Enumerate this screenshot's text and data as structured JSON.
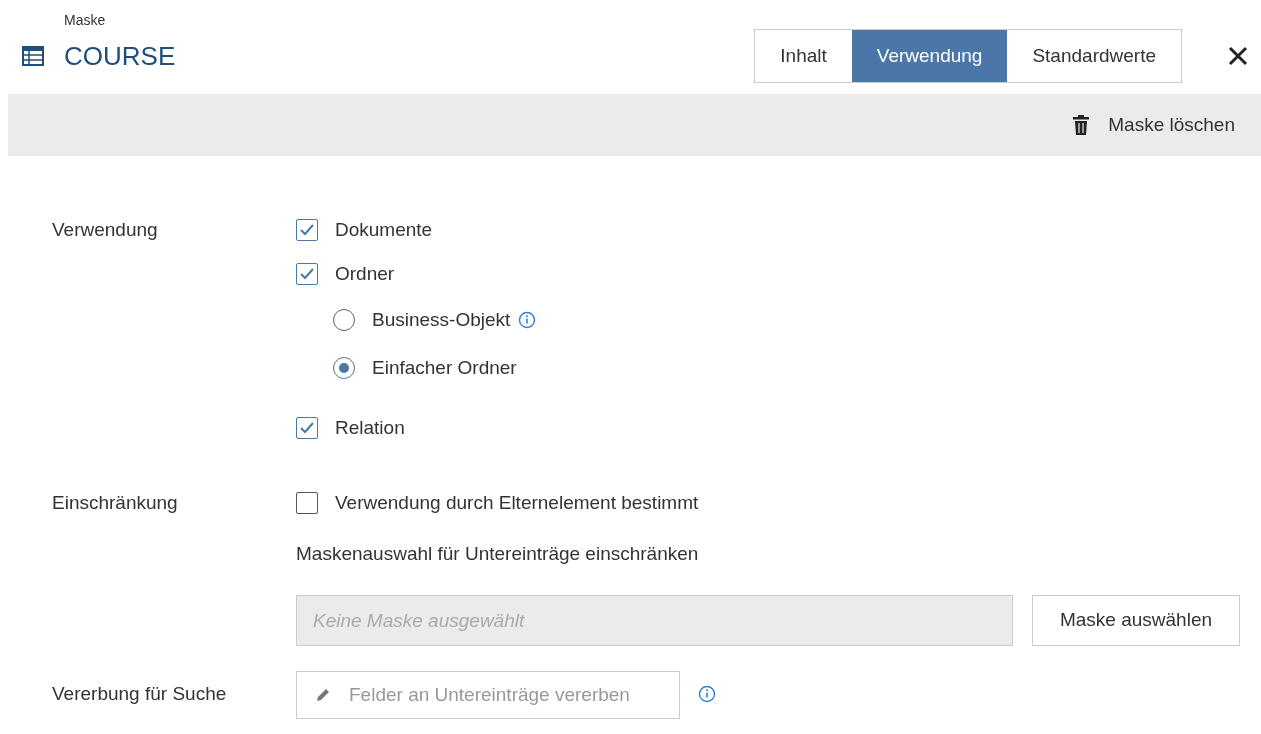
{
  "header": {
    "caption": "Maske",
    "title": "COURSE"
  },
  "tabs": [
    {
      "label": "Inhalt",
      "selected": false
    },
    {
      "label": "Verwendung",
      "selected": true
    },
    {
      "label": "Standardwerte",
      "selected": false
    }
  ],
  "toolbar": {
    "delete_label": "Maske löschen"
  },
  "usage": {
    "label": "Verwendung",
    "options": [
      {
        "kind": "checkbox",
        "label": "Dokumente",
        "checked": true
      },
      {
        "kind": "checkbox",
        "label": "Ordner",
        "checked": true
      },
      {
        "kind": "radio",
        "label": "Business-Objekt",
        "selected": false,
        "info": true
      },
      {
        "kind": "radio",
        "label": "Einfacher Ordner",
        "selected": true
      },
      {
        "kind": "checkbox",
        "label": "Relation",
        "checked": true
      }
    ]
  },
  "restriction": {
    "label": "Einschränkung",
    "checkbox": {
      "label": "Verwendung durch Elternelement bestimmt",
      "checked": false
    },
    "sublabel": "Maskenauswahl für Untereinträge einschränken",
    "field": {
      "placeholder": "Keine Maske ausgewählt"
    },
    "button": "Maske auswählen"
  },
  "inheritance": {
    "label": "Vererbung für Suche",
    "button": "Felder an Untereinträge vererben",
    "info": true
  }
}
